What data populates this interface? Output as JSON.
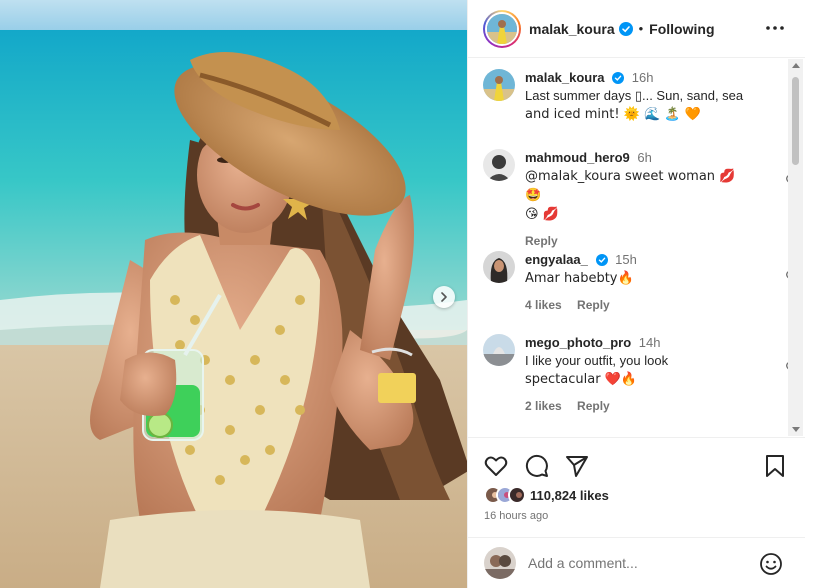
{
  "header": {
    "username": "malak_koura",
    "dot": "•",
    "follow_label": "Following",
    "more_icon": "more-horizontal-icon"
  },
  "caption": {
    "username": "malak_koura",
    "time": "16h",
    "text_line1": "Last summer days ▯... Sun, sand, sea",
    "text_line2": "and iced mint! 🌞 🌊 🏝️ 🧡"
  },
  "comments": [
    {
      "username": "mahmoud_hero9",
      "time": "6h",
      "text_line1": "@malak_koura sweet woman 💋 🤩",
      "text_line2": "😘 💋",
      "reply": "Reply"
    },
    {
      "username": "engyalaa_",
      "time": "15h",
      "text_line1": "Amar habebty🔥",
      "likes": "4 likes",
      "reply": "Reply"
    },
    {
      "username": "mego_photo_pro",
      "time": "14h",
      "text_line1": "I like your outfit, you look",
      "text_line2": "spectacular ❤️🔥",
      "likes": "2 likes",
      "reply": "Reply"
    }
  ],
  "actions": {
    "likes_count": "110,824 likes",
    "time_ago": "16 hours ago"
  },
  "add_comment": {
    "placeholder": "Add a comment..."
  },
  "colors": {
    "verified_blue": "#0095f6",
    "text": "#262626",
    "muted": "#737373",
    "border": "#efefef"
  }
}
